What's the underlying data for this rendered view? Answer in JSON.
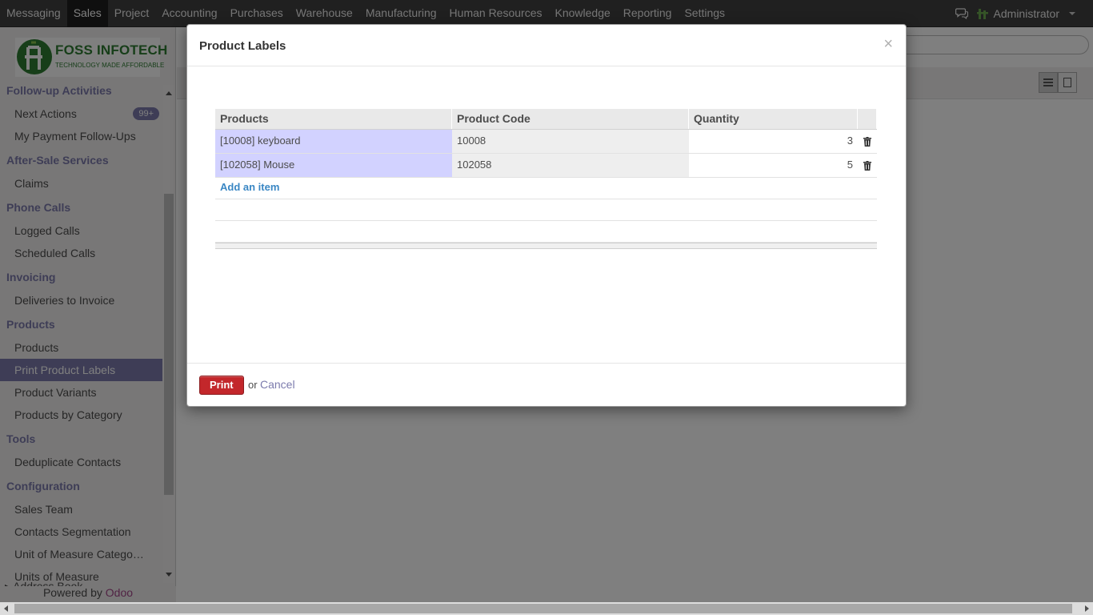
{
  "top_menu": {
    "items": [
      "Messaging",
      "Sales",
      "Project",
      "Accounting",
      "Purchases",
      "Warehouse",
      "Manufacturing",
      "Human Resources",
      "Knowledge",
      "Reporting",
      "Settings"
    ],
    "active": "Sales",
    "user": "Administrator"
  },
  "logo": {
    "name": "FOSS INFOTECH",
    "tagline": "TECHNOLOGY MADE AFFORDABLE"
  },
  "sidebar": {
    "sections": [
      {
        "title": "Follow-up Activities",
        "items": [
          {
            "label": "Next Actions",
            "badge": "99+"
          },
          {
            "label": "My Payment Follow-Ups"
          }
        ]
      },
      {
        "title": "After-Sale Services",
        "items": [
          {
            "label": "Claims"
          }
        ]
      },
      {
        "title": "Phone Calls",
        "items": [
          {
            "label": "Logged Calls"
          },
          {
            "label": "Scheduled Calls"
          }
        ]
      },
      {
        "title": "Invoicing",
        "items": [
          {
            "label": "Deliveries to Invoice"
          }
        ]
      },
      {
        "title": "Products",
        "items": [
          {
            "label": "Products"
          },
          {
            "label": "Print Product Labels",
            "active": true
          },
          {
            "label": "Product Variants"
          },
          {
            "label": "Products by Category"
          }
        ]
      },
      {
        "title": "Tools",
        "items": [
          {
            "label": "Deduplicate Contacts"
          }
        ]
      },
      {
        "title": "Configuration",
        "items": [
          {
            "label": "Sales Team"
          },
          {
            "label": "Contacts Segmentation"
          },
          {
            "label": "Unit of Measure Catego…"
          },
          {
            "label": "Units of Measure"
          }
        ]
      }
    ],
    "cut_item": "Address Book",
    "powered_prefix": "Powered by",
    "powered_brand": "Odoo"
  },
  "dialog": {
    "title": "Product Labels",
    "close": "×",
    "columns": [
      "Products",
      "Product Code",
      "Quantity"
    ],
    "rows": [
      {
        "product": "[10008] keyboard",
        "code": "10008",
        "qty": "3"
      },
      {
        "product": "[102058] Mouse",
        "code": "102058",
        "qty": "5"
      }
    ],
    "add_item": "Add an item",
    "print_label": "Print",
    "or_text": "or",
    "cancel_label": "Cancel"
  },
  "colors": {
    "accent": "#7c7bad",
    "print_button": "#c3272b",
    "link": "#3a87c4",
    "product_cell": "#d2d2ff"
  }
}
